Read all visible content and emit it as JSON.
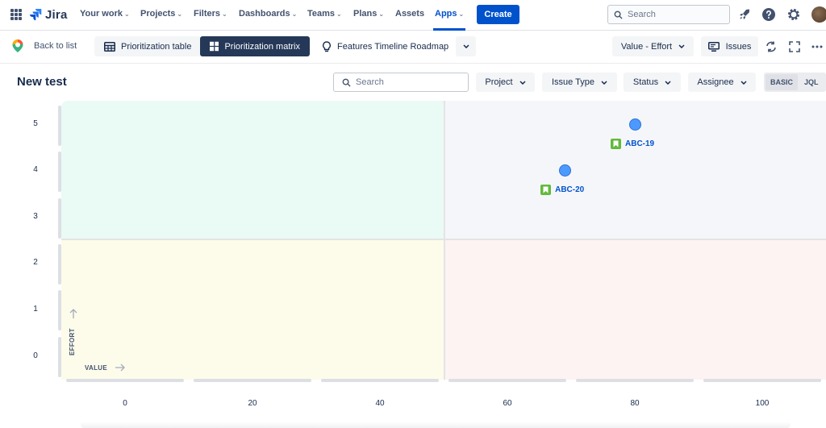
{
  "app": {
    "name": "Jira"
  },
  "nav": {
    "items": [
      {
        "label": "Your work",
        "dropdown": true
      },
      {
        "label": "Projects",
        "dropdown": true
      },
      {
        "label": "Filters",
        "dropdown": true
      },
      {
        "label": "Dashboards",
        "dropdown": true
      },
      {
        "label": "Teams",
        "dropdown": true
      },
      {
        "label": "Plans",
        "dropdown": true
      },
      {
        "label": "Assets",
        "dropdown": false
      },
      {
        "label": "Apps",
        "dropdown": true,
        "active": true
      }
    ],
    "create_label": "Create",
    "search_placeholder": "Search"
  },
  "toolbar": {
    "back_label": "Back to list",
    "views": [
      {
        "label": "Prioritization table",
        "icon": "table-icon"
      },
      {
        "label": "Prioritization matrix",
        "icon": "matrix-icon",
        "selected": true
      },
      {
        "label": "Features Timeline Roadmap",
        "icon": "lightbulb-icon"
      }
    ],
    "axis_select_label": "Value - Effort",
    "issues_label": "Issues"
  },
  "page": {
    "title": "New test",
    "search_placeholder": "Search",
    "filters": [
      "Project",
      "Issue Type",
      "Status",
      "Assignee"
    ],
    "mode_toggle": {
      "basic": "BASIC",
      "jql": "JQL",
      "selected": "BASIC"
    }
  },
  "chart_data": {
    "type": "scatter",
    "xlabel": "VALUE",
    "ylabel": "EFFORT",
    "x_ticks": [
      "0",
      "20",
      "40",
      "60",
      "80",
      "100"
    ],
    "y_ticks": [
      "5",
      "4",
      "3",
      "2",
      "1",
      "0"
    ],
    "xlim": [
      0,
      100
    ],
    "ylim": [
      0,
      5
    ],
    "quadrant_colors": {
      "top_left": "#eafaf4",
      "top_right": "#f5f6fa",
      "bottom_left": "#fdfbea",
      "bottom_right": "#fdf3f3"
    },
    "points": [
      {
        "key": "ABC-19",
        "x": 80,
        "y": 5,
        "type": "story"
      },
      {
        "key": "ABC-20",
        "x": 69,
        "y": 4,
        "type": "story"
      }
    ]
  },
  "colors": {
    "accent": "#0052cc",
    "story": "#63ba3c",
    "dot": "#4c9aff"
  }
}
